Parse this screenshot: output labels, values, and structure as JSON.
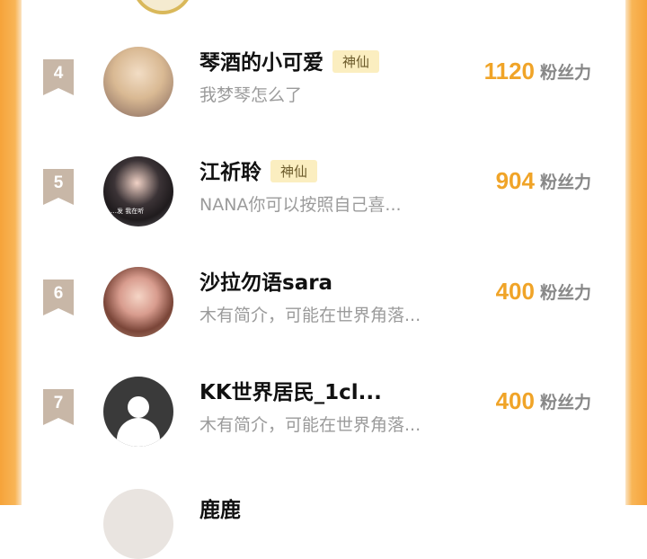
{
  "rows": [
    {
      "rank": "4",
      "name": "琴酒的小可爱",
      "tag": "神仙",
      "desc": "我梦琴怎么了",
      "fans": "1120",
      "unit": "粉丝力"
    },
    {
      "rank": "5",
      "name": "江祈聆",
      "tag": "神仙",
      "desc": "NANA你可以按照自己喜...",
      "fans": "904",
      "unit": "粉丝力",
      "avatar_caption": "…发 我在听"
    },
    {
      "rank": "6",
      "name": "沙拉勿语sara",
      "tag": "",
      "desc": "木有简介，可能在世界角落...",
      "fans": "400",
      "unit": "粉丝力"
    },
    {
      "rank": "7",
      "name": "KK世界居民_1cl...",
      "tag": "",
      "desc": "木有简介，可能在世界角落...",
      "fans": "400",
      "unit": "粉丝力"
    }
  ],
  "next_row": {
    "name": "鹿鹿"
  },
  "colors": {
    "accent": "#f0a428",
    "tag_bg": "#fbeec0",
    "rank_badge": "#c8b7a7",
    "side_bar": "#f6a33a"
  }
}
